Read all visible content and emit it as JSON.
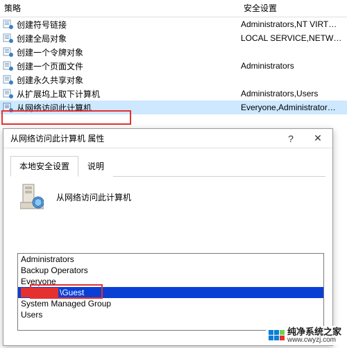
{
  "columns": {
    "policy": "策略",
    "security": "安全设置"
  },
  "rows": [
    {
      "name": "创建符号链接",
      "sec": "Administrators,NT VIRT…"
    },
    {
      "name": "创建全局对象",
      "sec": "LOCAL SERVICE,NETW…"
    },
    {
      "name": "创建一个令牌对象",
      "sec": ""
    },
    {
      "name": "创建一个页面文件",
      "sec": "Administrators"
    },
    {
      "name": "创建永久共享对象",
      "sec": ""
    },
    {
      "name": "从扩展坞上取下计算机",
      "sec": "Administrators,Users"
    },
    {
      "name": "从网络访问此计算机",
      "sec": "Everyone,Administrator…"
    }
  ],
  "dialog": {
    "title": "从网络访问此计算机 属性",
    "tabs": {
      "local": "本地安全设置",
      "explain": "说明"
    },
    "heading": "从网络访问此计算机",
    "list": [
      {
        "label": "Administrators"
      },
      {
        "label": "Backup Operators"
      },
      {
        "label": "Everyone"
      },
      {
        "label": "\\Guest",
        "selected": true,
        "redact": true
      },
      {
        "label": "System Managed Group"
      },
      {
        "label": "Users"
      }
    ]
  },
  "watermark": {
    "brand": "纯净系统之家",
    "url": "www.cwyzj.com"
  }
}
